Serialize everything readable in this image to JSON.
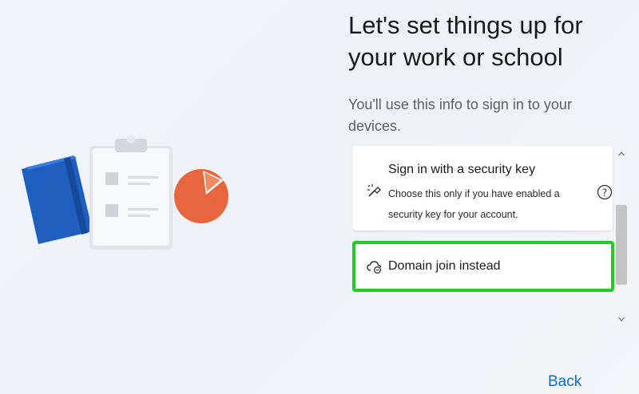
{
  "header": {
    "title": "Let's set things up for your work or school",
    "subtitle": "You'll use this info to sign in to your devices."
  },
  "options": [
    {
      "title": "Sign in with a security key",
      "description": "Choose this only if you have enabled a security key for your account.",
      "icon": "security-key-icon",
      "help_icon": "help-icon"
    },
    {
      "title": "Domain join instead",
      "icon": "cloud-domain-icon",
      "highlighted": true
    }
  ],
  "footer": {
    "back_label": "Back"
  },
  "colors": {
    "accent": "#0f6cbd",
    "highlight": "#22cc22",
    "background": "#eef2f7"
  }
}
